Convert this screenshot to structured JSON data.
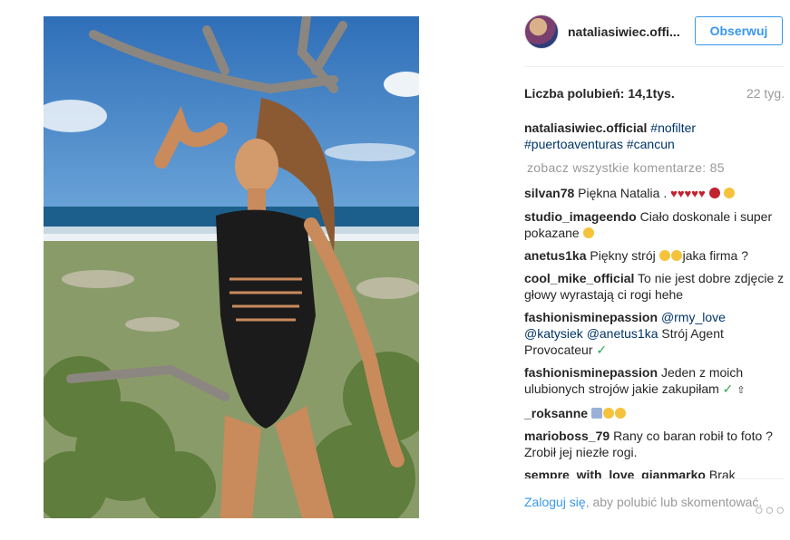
{
  "post": {
    "username": "nataliasiwiec.offi...",
    "follow_label": "Obserwuj",
    "likes": "Liczba polubień: 14,1tys.",
    "age": "22 tyg.",
    "caption_user": "nataliasiwiec.official",
    "caption_tags": [
      "#nofilter",
      "#puertoaventuras",
      "#cancun"
    ],
    "view_all": "zobacz wszystkie komentarze: 85"
  },
  "comments": [
    {
      "user": "silvan78",
      "text": "Piękna Natalia ."
    },
    {
      "user": "studio_imageendo",
      "text": "Ciało doskonale i super pokazane"
    },
    {
      "user": "anetus1ka",
      "text_a": "Piękny strój",
      "text_b": "jaka firma ?"
    },
    {
      "user": "cool_mike_official",
      "text": "To nie jest dobre zdjęcie z głowy wyrastają ci rogi hehe"
    },
    {
      "user": "fashionisminepassion",
      "mention1": "@rmy_love",
      "mention2": "@katysiek",
      "mention3": "@anetus1ka",
      "text": "Strój Agent Provocateur"
    },
    {
      "user": "fashionisminepassion",
      "text": "Jeden z moich ulubionych strojów jakie zakupiłam"
    },
    {
      "user": "_roksanne",
      "text": ""
    },
    {
      "user": "marioboss_79",
      "text": "Rany co baran robił to foto ? Zrobił jej niezłe rogi."
    },
    {
      "user": "sempre_with_love_gianmarko",
      "text": "Brak"
    }
  ],
  "footer": {
    "login_label": "Zaloguj się",
    "rest": ", aby polubić lub skomentować.",
    "more": "○○○"
  },
  "colors": {
    "link": "#3897f0",
    "hashtag": "#003569",
    "muted": "#999999"
  }
}
